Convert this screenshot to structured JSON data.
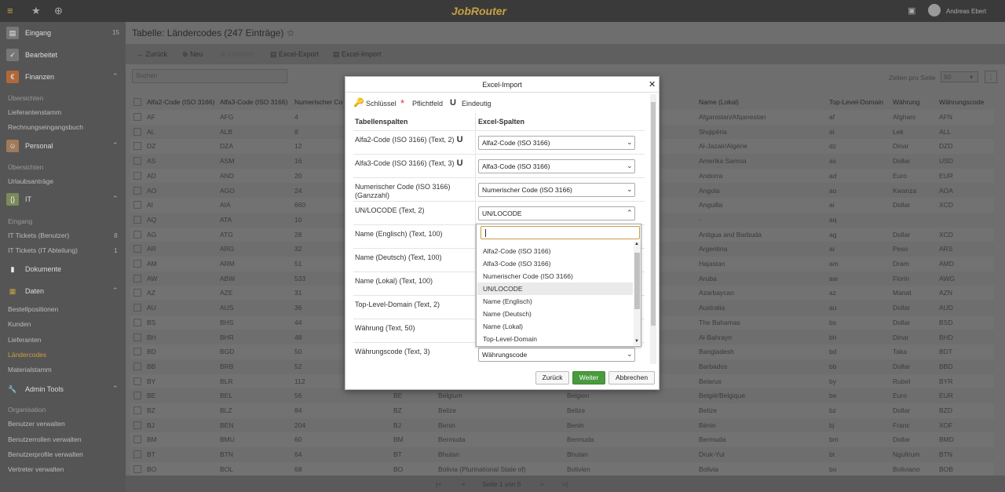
{
  "app": {
    "logo": "JobRouter",
    "user_name": "Andreas Ebert"
  },
  "sidebar": {
    "groups": [
      {
        "label": "Eingang",
        "count": "15"
      },
      {
        "label": "Bearbeitet"
      },
      {
        "label": "Finanzen"
      },
      {
        "label": "Personal"
      },
      {
        "label": "IT"
      },
      {
        "label": "Dokumente"
      },
      {
        "label": "Daten"
      },
      {
        "label": "Admin Tools"
      }
    ],
    "finanzen": [
      "Übersichten",
      "Lieferantenstamm",
      "Rechnungseingangsbuch"
    ],
    "personal": [
      "Übersichten",
      "Urlaubsanträge"
    ],
    "it": {
      "cat": "Eingang",
      "items": [
        {
          "label": "IT Tickets (Benutzer)",
          "count": "8"
        },
        {
          "label": "IT Tickets (IT Abteilung)",
          "count": "1"
        }
      ]
    },
    "daten": [
      "Bestellpositionen",
      "Kunden",
      "Lieferanten",
      "Ländercodes",
      "Materialstamm"
    ],
    "admin": {
      "cat": "Organisation",
      "items": [
        "Benutzer verwalten",
        "Benutzerrollen verwalten",
        "Benutzerprofile verwalten",
        "Vertreter verwalten"
      ]
    }
  },
  "page": {
    "title": "Tabelle: Ländercodes (247 Einträge)"
  },
  "toolbar": {
    "back": "Zurück",
    "new": "Neu",
    "delete": "Löschen",
    "excel_export": "Excel-Export",
    "excel_import": "Excel-Import"
  },
  "search": {
    "placeholder": "Suchen"
  },
  "paging": {
    "per_page_label": "Zeilen pro Seite",
    "per_page_value": "50",
    "page_text": "Seite 1 von 5"
  },
  "table": {
    "headers": [
      "Alfa2-Code (ISO 3166)",
      "Alfa3-Code (ISO 3166)",
      "Numerischer Code",
      "",
      "",
      "",
      "Name (Lokal)",
      "Top-Level-Domain",
      "Währung",
      "Währungscode"
    ],
    "rows": [
      [
        "AF",
        "AFG",
        "4",
        "",
        "",
        "",
        "Afganistan/Afqanestan",
        "af",
        "Afghani",
        "AFN"
      ],
      [
        "AL",
        "ALB",
        "8",
        "",
        "",
        "",
        "Shqipëria",
        "al",
        "Lek",
        "ALL"
      ],
      [
        "DZ",
        "DZA",
        "12",
        "",
        "",
        "",
        "Al-Jazair/Algérie",
        "dz",
        "Dinar",
        "DZD"
      ],
      [
        "AS",
        "ASM",
        "16",
        "",
        "",
        "",
        "Amerika Samoa",
        "as",
        "Dollar",
        "USD"
      ],
      [
        "AD",
        "AND",
        "20",
        "",
        "",
        "",
        "Andorra",
        "ad",
        "Euro",
        "EUR"
      ],
      [
        "AO",
        "AGO",
        "24",
        "",
        "",
        "",
        "Angola",
        "ao",
        "Kwanza",
        "AOA"
      ],
      [
        "AI",
        "AIA",
        "660",
        "",
        "",
        "",
        "Anguilla",
        "ai",
        "Dollar",
        "XCD"
      ],
      [
        "AQ",
        "ATA",
        "10",
        "",
        "",
        "",
        "-",
        "aq",
        "",
        ""
      ],
      [
        "AG",
        "ATG",
        "28",
        "",
        "",
        "",
        "Antigua and Barbuda",
        "ag",
        "Dollar",
        "XCD"
      ],
      [
        "AR",
        "ARG",
        "32",
        "",
        "",
        "",
        "Argentina",
        "ar",
        "Peso",
        "ARS"
      ],
      [
        "AM",
        "ARM",
        "51",
        "",
        "",
        "",
        "Hajastan",
        "am",
        "Dram",
        "AMD"
      ],
      [
        "AW",
        "ABW",
        "533",
        "",
        "",
        "",
        "Aruba",
        "aw",
        "Florin",
        "AWG"
      ],
      [
        "AZ",
        "AZE",
        "31",
        "",
        "",
        "",
        "Azarbaycan",
        "az",
        "Manat",
        "AZN"
      ],
      [
        "AU",
        "AUS",
        "36",
        "",
        "",
        "",
        "Australia",
        "au",
        "Dollar",
        "AUD"
      ],
      [
        "BS",
        "BHS",
        "44",
        "",
        "",
        "",
        "The Bahamas",
        "bs",
        "Dollar",
        "BSD"
      ],
      [
        "BH",
        "BHR",
        "48",
        "",
        "",
        "",
        "Al-Bahrayn",
        "bh",
        "Dinar",
        "BHD"
      ],
      [
        "BD",
        "BGD",
        "50",
        "",
        "",
        "",
        "Bangladesh",
        "bd",
        "Taka",
        "BDT"
      ],
      [
        "BB",
        "BRB",
        "52",
        "",
        "",
        "",
        "Barbados",
        "bb",
        "Dollar",
        "BBD"
      ],
      [
        "BY",
        "BLR",
        "112",
        "",
        "",
        "",
        "Belarus",
        "by",
        "Rubel",
        "BYR"
      ],
      [
        "BE",
        "BEL",
        "56",
        "BE",
        "Belgium",
        "Belgien",
        "België/Belgique",
        "be",
        "Euro",
        "EUR"
      ],
      [
        "BZ",
        "BLZ",
        "84",
        "BZ",
        "Belize",
        "Belize",
        "Belize",
        "bz",
        "Dollar",
        "BZD"
      ],
      [
        "BJ",
        "BEN",
        "204",
        "BJ",
        "Benin",
        "Benin",
        "Bénin",
        "bj",
        "Franc",
        "XOF"
      ],
      [
        "BM",
        "BMU",
        "60",
        "BM",
        "Bermuda",
        "Bermuda",
        "Bermuda",
        "bm",
        "Dollar",
        "BMD"
      ],
      [
        "BT",
        "BTN",
        "64",
        "BT",
        "Bhutan",
        "Bhutan",
        "Druk-Yul",
        "bt",
        "Ngultrum",
        "BTN"
      ],
      [
        "BO",
        "BOL",
        "68",
        "BO",
        "Bolivia (Plurinational State of)",
        "Bolivien",
        "Bolivia",
        "bo",
        "Boliviano",
        "BOB"
      ]
    ]
  },
  "modal": {
    "title": "Excel-Import",
    "legend": {
      "key": "Schlüssel",
      "required": "Pflichtfeld",
      "unique_mark": "U",
      "unique": "Eindeutig"
    },
    "col_table": "Tabellenspalten",
    "col_excel": "Excel-Spalten",
    "rows": [
      {
        "label": "Alfa2-Code (ISO 3166) (Text, 2)",
        "u": "U",
        "value": "Alfa2-Code (ISO 3166)"
      },
      {
        "label": "Alfa3-Code (ISO 3166) (Text, 3)",
        "u": "U",
        "value": "Alfa3-Code (ISO 3166)"
      },
      {
        "label": "Numerischer Code (ISO 3166) (Ganzzahl)",
        "value": "Numerischer Code (ISO 3166)"
      },
      {
        "label": "UN/LOCODE (Text, 2)",
        "value": "UN/LOCODE"
      },
      {
        "label": "Name (Englisch) (Text, 100)"
      },
      {
        "label": "Name (Deutsch) (Text, 100)"
      },
      {
        "label": "Name (Lokal) (Text, 100)"
      },
      {
        "label": "Top-Level-Domain (Text, 2)"
      },
      {
        "label": "Währung (Text, 50)"
      },
      {
        "label": "Währungscode (Text, 3)",
        "value": "Währungscode"
      }
    ],
    "dropdown_options": [
      "Alfa2-Code (ISO 3166)",
      "Alfa3-Code (ISO 3166)",
      "Numerischer Code (ISO 3166)",
      "UN/LOCODE",
      "Name (Englisch)",
      "Name (Deutsch)",
      "Name (Lokal)",
      "Top-Level-Domain"
    ],
    "dropdown_selected": "UN/LOCODE",
    "buttons": {
      "back": "Zurück",
      "next": "Weiter",
      "cancel": "Abbrechen"
    }
  },
  "colors": {
    "accent": "#c8a043",
    "primary_button": "#4a9a3e"
  }
}
